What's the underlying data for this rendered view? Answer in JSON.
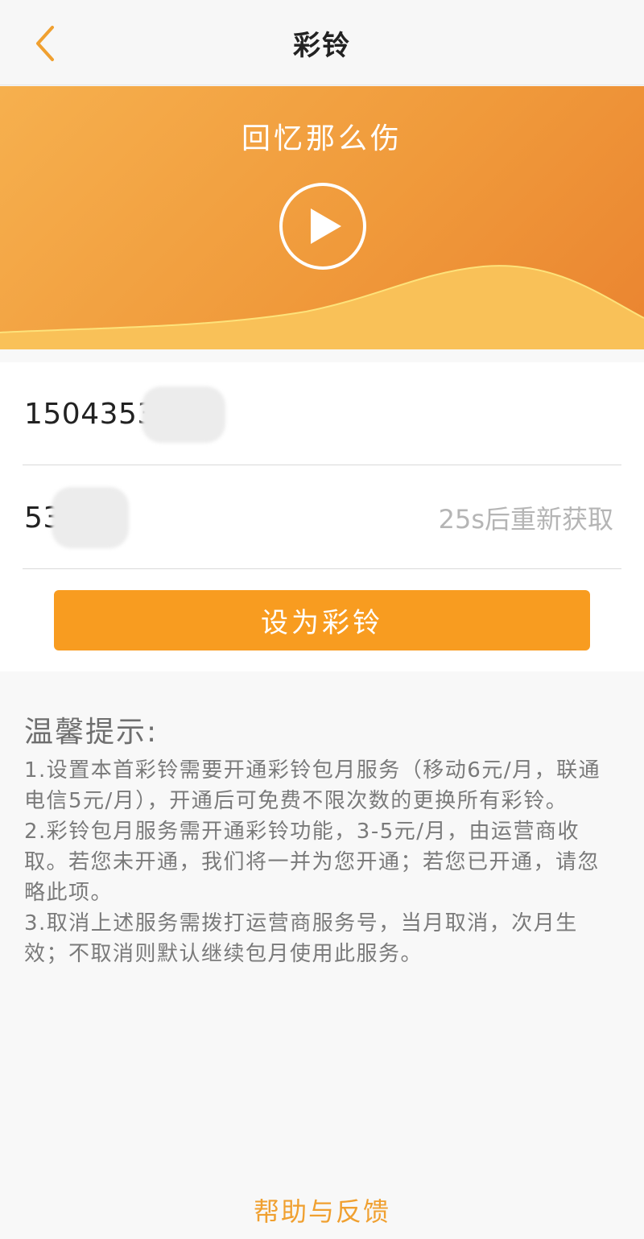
{
  "nav": {
    "title": "彩铃",
    "back_icon": "chevron-left-icon"
  },
  "hero": {
    "song_title": "回忆那么伤",
    "play_icon": "play-icon"
  },
  "form": {
    "phone_value": "1504353",
    "code_value": "53",
    "resend_label": "25s后重新获取"
  },
  "action": {
    "set_label": "设为彩铃"
  },
  "tips": {
    "heading": "温馨提示:",
    "line1": "1.设置本首彩铃需要开通彩铃包月服务（移动6元/月，联通电信5元/月），开通后可免费不限次数的更换所有彩铃。",
    "line2": "2.彩铃包月服务需开通彩铃功能，3-5元/月，由运营商收取。若您未开通，我们将一并为您开通；若您已开通，请忽略此项。",
    "line3": "3.取消上述服务需拨打运营商服务号，当月取消，次月生效；不取消则默认继续包月使用此服务。"
  },
  "footer": {
    "help_label": "帮助与反馈"
  },
  "colors": {
    "accent": "#f89c20",
    "hero_start": "#f6b04e",
    "hero_end": "#ea8430",
    "wave": "#f9c158",
    "help_text": "#f0a030"
  }
}
